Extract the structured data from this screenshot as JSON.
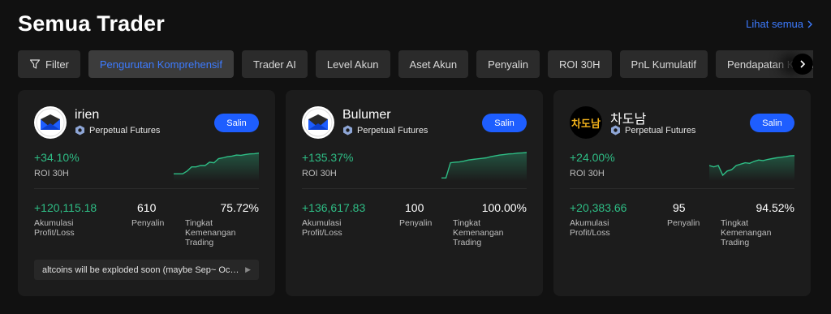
{
  "header": {
    "title": "Semua Trader",
    "see_all": "Lihat semua"
  },
  "filters": [
    {
      "label": "Filter",
      "icon": "filter-icon",
      "active": false
    },
    {
      "label": "Pengurutan Komprehensif",
      "active": true
    },
    {
      "label": "Trader AI",
      "active": false
    },
    {
      "label": "Level Akun",
      "active": false
    },
    {
      "label": "Aset Akun",
      "active": false
    },
    {
      "label": "Penyalin",
      "active": false
    },
    {
      "label": "ROI 30H",
      "active": false
    },
    {
      "label": "PnL Kumulatif",
      "active": false
    },
    {
      "label": "Pendapatan Kumulatif",
      "active": false
    }
  ],
  "colors": {
    "accent": "#1e5eff",
    "link": "#3d7bff",
    "positive": "#2ebd85",
    "card_bg": "#1c1c1c",
    "page_bg": "#111111"
  },
  "traders": [
    {
      "name": "irien",
      "avatar": "envelope-logo",
      "tag": "Perpetual Futures",
      "copy_label": "Salin",
      "roi": "+34.10%",
      "roi_label": "ROI 30H",
      "profit": "+120,115.18",
      "profit_label": "Akumulasi Profit/Loss",
      "copiers": "610",
      "copiers_label": "Penyalin",
      "win_rate": "75.72%",
      "win_label": "Tingkat Kemenangan Trading",
      "note": "altcoins will be exploded soon (maybe Sep~ Oct.) I...",
      "sparkline": [
        0.2,
        0.2,
        0.2,
        0.3,
        0.45,
        0.45,
        0.5,
        0.5,
        0.62,
        0.6,
        0.75,
        0.78,
        0.82,
        0.84,
        0.88,
        0.87,
        0.9,
        0.92,
        0.93,
        0.95
      ]
    },
    {
      "name": "Bulumer",
      "avatar": "envelope-logo",
      "tag": "Perpetual Futures",
      "copy_label": "Salin",
      "roi": "+135.37%",
      "roi_label": "ROI 30H",
      "profit": "+136,617.83",
      "profit_label": "Akumulasi Profit/Loss",
      "copiers": "100",
      "copiers_label": "Penyalin",
      "win_rate": "100.00%",
      "win_label": "Tingkat Kemenangan Trading",
      "note": "",
      "sparkline": [
        0.05,
        0.05,
        0.6,
        0.62,
        0.63,
        0.66,
        0.7,
        0.72,
        0.74,
        0.76,
        0.78,
        0.82,
        0.85,
        0.88,
        0.9,
        0.92,
        0.93,
        0.95,
        0.96,
        0.97
      ]
    },
    {
      "name": "차도남",
      "avatar": "chadonam-logo",
      "avatar_text": "차도남",
      "tag": "Perpetual Futures",
      "copy_label": "Salin",
      "roi": "+24.00%",
      "roi_label": "ROI 30H",
      "profit": "+20,383.66",
      "profit_label": "Akumulasi Profit/Loss",
      "copiers": "95",
      "copiers_label": "Penyalin",
      "win_rate": "94.52%",
      "win_label": "Tingkat Kemenangan Trading",
      "note": "",
      "sparkline": [
        0.5,
        0.45,
        0.5,
        0.15,
        0.3,
        0.35,
        0.5,
        0.55,
        0.6,
        0.58,
        0.65,
        0.7,
        0.68,
        0.72,
        0.75,
        0.78,
        0.8,
        0.82,
        0.85,
        0.86
      ]
    }
  ]
}
